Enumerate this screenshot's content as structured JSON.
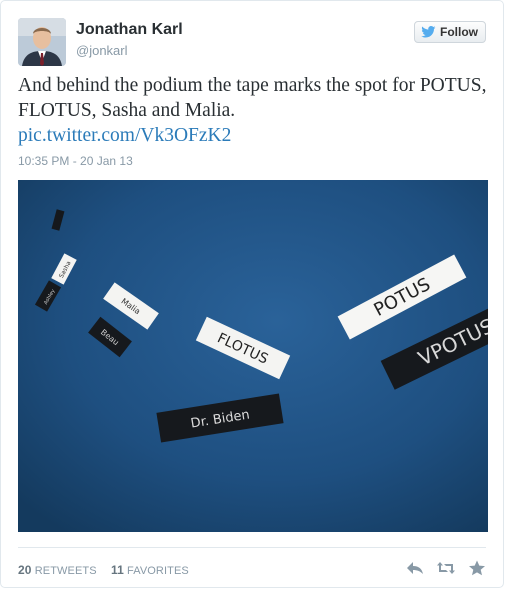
{
  "tweet": {
    "author_name": "Jonathan Karl",
    "author_handle": "@jonkarl",
    "follow_label": "Follow",
    "text": "And behind the podium the tape marks the spot for POTUS, FLOTUS, Sasha and Malia.",
    "link": "pic.twitter.com/Vk3OFzK2",
    "timestamp": "10:35 PM - 20 Jan 13"
  },
  "photo": {
    "tape_labels": {
      "sasha": "Sasha",
      "malia": "Malia",
      "flotus": "FLOTUS",
      "potus": "POTUS",
      "vpotus": "VPOTUS",
      "biden": "Dr. Biden",
      "beau": "Beau",
      "hunter": "Hun",
      "other": "Ashley"
    }
  },
  "stats": {
    "retweets_count": "20",
    "retweets_label": "RETWEETS",
    "favorites_count": "11",
    "favorites_label": "FAVORITES"
  },
  "actions": {
    "reply_icon": "reply-icon",
    "retweet_icon": "retweet-icon",
    "favorite_icon": "favorite-icon"
  },
  "colors": {
    "link": "#2b7bb9",
    "carpet": "#1d4a74",
    "muted": "#8899a6"
  }
}
